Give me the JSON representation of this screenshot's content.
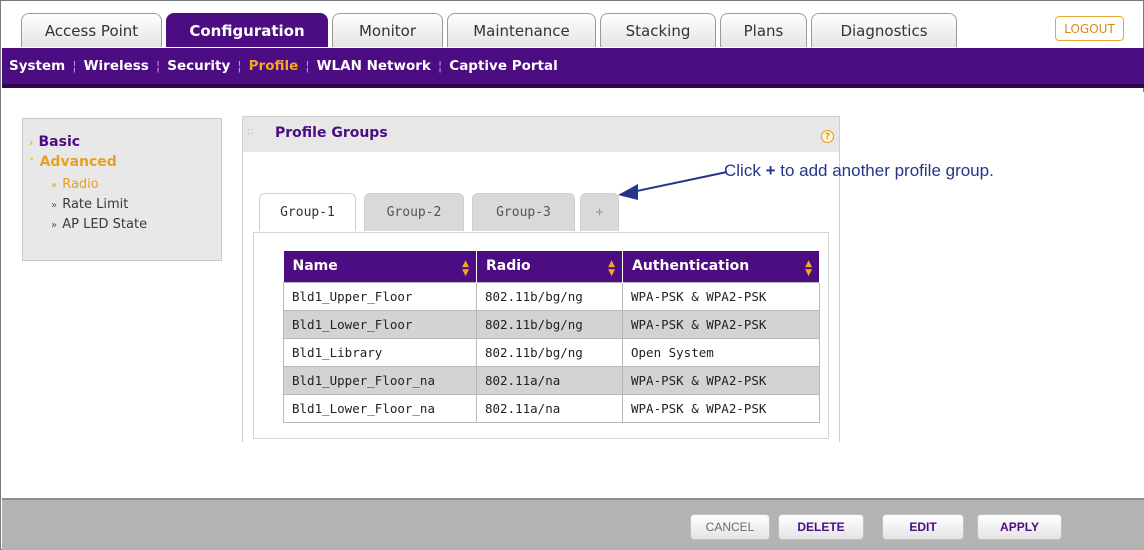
{
  "top_tabs": [
    {
      "label": "Access Point",
      "active": false
    },
    {
      "label": "Configuration",
      "active": true
    },
    {
      "label": "Monitor",
      "active": false
    },
    {
      "label": "Maintenance",
      "active": false
    },
    {
      "label": "Stacking",
      "active": false
    },
    {
      "label": "Plans",
      "active": false
    },
    {
      "label": "Diagnostics",
      "active": false
    }
  ],
  "logout_label": "LOGOUT",
  "subnav": [
    {
      "label": "System",
      "active": false
    },
    {
      "label": "Wireless",
      "active": false
    },
    {
      "label": "Security",
      "active": false
    },
    {
      "label": "Profile",
      "active": true
    },
    {
      "label": "WLAN Network",
      "active": false
    },
    {
      "label": "Captive Portal",
      "active": false
    }
  ],
  "left_nav": {
    "basic": "Basic",
    "advanced": "Advanced",
    "items": [
      "Radio",
      "Rate Limit",
      "AP LED State"
    ]
  },
  "panel": {
    "title": "Profile Groups",
    "tabs": [
      "Group-1",
      "Group-2",
      "Group-3",
      "+"
    ],
    "active_tab": "Group-1"
  },
  "table": {
    "columns": [
      "Name",
      "Radio",
      "Authentication"
    ],
    "rows": [
      [
        "Bld1_Upper_Floor",
        "802.11b/bg/ng",
        "WPA-PSK & WPA2-PSK"
      ],
      [
        "Bld1_Lower_Floor",
        "802.11b/bg/ng",
        "WPA-PSK & WPA2-PSK"
      ],
      [
        "Bld1_Library",
        "802.11b/bg/ng",
        "Open System"
      ],
      [
        "Bld1_Upper_Floor_na",
        "802.11a/na",
        "WPA-PSK & WPA2-PSK"
      ],
      [
        "Bld1_Lower_Floor_na",
        "802.11a/na",
        "WPA-PSK & WPA2-PSK"
      ]
    ]
  },
  "callout": {
    "before": "Click ",
    "plus": "+",
    "after": " to add another profile group."
  },
  "buttons": {
    "cancel": "CANCEL",
    "delete": "DELETE",
    "edit": "EDIT",
    "apply": "APPLY"
  },
  "colors": {
    "brand_purple": "#4c0c82",
    "accent_orange": "#f5a623",
    "callout_blue": "#233689"
  }
}
